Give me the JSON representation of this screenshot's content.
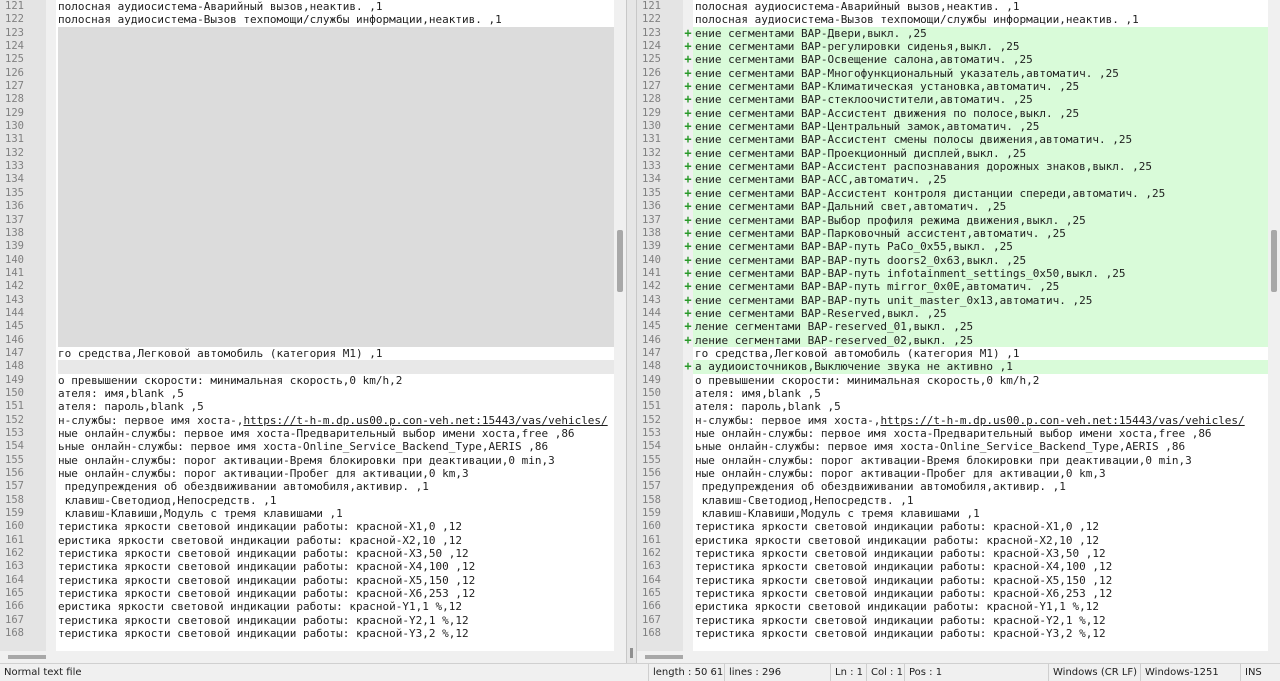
{
  "left_pane": {
    "rows": [
      {
        "n": "121",
        "type": "normal",
        "text": "полосная аудиосистема-Аварийный вызов,неактив. ,1"
      },
      {
        "n": "122",
        "type": "normal",
        "text": "полосная аудиосистема-Вызов техпомощи/службы информации,неактив. ,1"
      },
      {
        "n": "123",
        "type": "blank",
        "text": ""
      },
      {
        "n": "124",
        "type": "blank",
        "text": ""
      },
      {
        "n": "125",
        "type": "blank",
        "text": ""
      },
      {
        "n": "126",
        "type": "blank",
        "text": ""
      },
      {
        "n": "127",
        "type": "blank",
        "text": ""
      },
      {
        "n": "128",
        "type": "blank",
        "text": ""
      },
      {
        "n": "129",
        "type": "blank",
        "text": ""
      },
      {
        "n": "130",
        "type": "blank",
        "text": ""
      },
      {
        "n": "131",
        "type": "blank",
        "text": ""
      },
      {
        "n": "132",
        "type": "blank",
        "text": ""
      },
      {
        "n": "133",
        "type": "blank",
        "text": ""
      },
      {
        "n": "134",
        "type": "blank",
        "text": ""
      },
      {
        "n": "135",
        "type": "blank",
        "text": ""
      },
      {
        "n": "136",
        "type": "blank",
        "text": ""
      },
      {
        "n": "137",
        "type": "blank",
        "text": ""
      },
      {
        "n": "138",
        "type": "blank",
        "text": ""
      },
      {
        "n": "139",
        "type": "blank",
        "text": ""
      },
      {
        "n": "140",
        "type": "blank",
        "text": ""
      },
      {
        "n": "141",
        "type": "blank",
        "text": ""
      },
      {
        "n": "142",
        "type": "blank",
        "text": ""
      },
      {
        "n": "143",
        "type": "blank",
        "text": ""
      },
      {
        "n": "144",
        "type": "blank",
        "text": ""
      },
      {
        "n": "145",
        "type": "blank",
        "text": ""
      },
      {
        "n": "146",
        "type": "blank",
        "text": ""
      },
      {
        "n": "147",
        "type": "normal",
        "text": "го средства,Легковой автомобиль (категория M1) ,1"
      },
      {
        "n": "148",
        "type": "changed",
        "text": ""
      },
      {
        "n": "149",
        "type": "normal",
        "text": "о превышении скорости: минимальная скорость,0 km/h,2"
      },
      {
        "n": "150",
        "type": "normal",
        "text": "ателя: имя,blank ,5"
      },
      {
        "n": "151",
        "type": "normal",
        "text": "ателя: пароль,blank ,5"
      },
      {
        "n": "152",
        "type": "normal",
        "text": "н-службы: первое имя хоста-,",
        "link": "https://t-h-m.dp.us00.p.con-veh.net:15443/vas/vehicles/"
      },
      {
        "n": "153",
        "type": "normal",
        "text": "ные онлайн-службы: первое имя хоста-Предварительный выбор имени хоста,free ,86"
      },
      {
        "n": "154",
        "type": "normal",
        "text": "ьные онлайн-службы: первое имя хоста-Online_Service_Backend_Type,AERIS ,86"
      },
      {
        "n": "155",
        "type": "normal",
        "text": "ные онлайн-службы: порог активации-Время блокировки при деактивации,0 min,3"
      },
      {
        "n": "156",
        "type": "normal",
        "text": "ные онлайн-службы: порог активации-Пробег для активации,0 km,3"
      },
      {
        "n": "157",
        "type": "normal",
        "text": " предупреждения об обездвиживании автомобиля,активир. ,1"
      },
      {
        "n": "158",
        "type": "normal",
        "text": " клавиш-Светодиод,Непосредств. ,1"
      },
      {
        "n": "159",
        "type": "normal",
        "text": " клавиш-Клавиши,Модуль с тремя клавишами ,1"
      },
      {
        "n": "160",
        "type": "normal",
        "text": "теристика яркости световой индикации работы: красной-X1,0 ,12"
      },
      {
        "n": "161",
        "type": "normal",
        "text": "еристика яркости световой индикации работы: красной-X2,10 ,12"
      },
      {
        "n": "162",
        "type": "normal",
        "text": "теристика яркости световой индикации работы: красной-X3,50 ,12"
      },
      {
        "n": "163",
        "type": "normal",
        "text": "теристика яркости световой индикации работы: красной-X4,100 ,12"
      },
      {
        "n": "164",
        "type": "normal",
        "text": "теристика яркости световой индикации работы: красной-X5,150 ,12"
      },
      {
        "n": "165",
        "type": "normal",
        "text": "теристика яркости световой индикации работы: красной-X6,253 ,12"
      },
      {
        "n": "166",
        "type": "normal",
        "text": "еристика яркости световой индикации работы: красной-Y1,1 %,12"
      },
      {
        "n": "167",
        "type": "normal",
        "text": "теристика яркости световой индикации работы: красной-Y2,1 %,12"
      },
      {
        "n": "168",
        "type": "normal",
        "text": "теристика яркости световой индикации работы: красной-Y3,2 %,12"
      }
    ]
  },
  "right_pane": {
    "rows": [
      {
        "n": "121",
        "type": "normal",
        "text": "полосная аудиосистема-Аварийный вызов,неактив. ,1"
      },
      {
        "n": "122",
        "type": "normal",
        "text": "полосная аудиосистема-Вызов техпомощи/службы информации,неактив. ,1"
      },
      {
        "n": "123",
        "type": "added",
        "text": "ение сегментами BAP-Двери,выкл. ,25"
      },
      {
        "n": "124",
        "type": "added",
        "text": "ение сегментами BAP-регулировки сиденья,выкл. ,25"
      },
      {
        "n": "125",
        "type": "added",
        "text": "ение сегментами BAP-Освещение салона,автоматич. ,25"
      },
      {
        "n": "126",
        "type": "added",
        "text": "ение сегментами BAP-Многофункциональный указатель,автоматич. ,25"
      },
      {
        "n": "127",
        "type": "added",
        "text": "ение сегментами BAP-Климатическая установка,автоматич. ,25"
      },
      {
        "n": "128",
        "type": "added",
        "text": "ение сегментами BAP-стеклоочистители,автоматич. ,25"
      },
      {
        "n": "129",
        "type": "added",
        "text": "ение сегментами BAP-Ассистент движения по полосе,выкл. ,25"
      },
      {
        "n": "130",
        "type": "added",
        "text": "ение сегментами BAP-Центральный замок,автоматич. ,25"
      },
      {
        "n": "131",
        "type": "added",
        "text": "ение сегментами BAP-Ассистент смены полосы движения,автоматич. ,25"
      },
      {
        "n": "132",
        "type": "added",
        "text": "ение сегментами BAP-Проекционный дисплей,выкл. ,25"
      },
      {
        "n": "133",
        "type": "added",
        "text": "ение сегментами BAP-Ассистент распознавания дорожных знаков,выкл. ,25"
      },
      {
        "n": "134",
        "type": "added",
        "text": "ение сегментами BAP-ACC,автоматич. ,25"
      },
      {
        "n": "135",
        "type": "added",
        "text": "ение сегментами BAP-Ассистент контроля дистанции спереди,автоматич. ,25"
      },
      {
        "n": "136",
        "type": "added",
        "text": "ение сегментами BAP-Дальний свет,автоматич. ,25"
      },
      {
        "n": "137",
        "type": "added",
        "text": "ение сегментами BAP-Выбор профиля режима движения,выкл. ,25"
      },
      {
        "n": "138",
        "type": "added",
        "text": "ение сегментами BAP-Парковочный ассистент,автоматич. ,25"
      },
      {
        "n": "139",
        "type": "added",
        "text": "ение сегментами BAP-BAP-путь PaCo_0x55,выкл. ,25"
      },
      {
        "n": "140",
        "type": "added",
        "text": "ение сегментами BAP-BAP-путь doors2_0x63,выкл. ,25"
      },
      {
        "n": "141",
        "type": "added",
        "text": "ение сегментами BAP-BAP-путь infotainment_settings_0x50,выкл. ,25"
      },
      {
        "n": "142",
        "type": "added",
        "text": "ение сегментами BAP-BAP-путь mirror_0x0E,автоматич. ,25"
      },
      {
        "n": "143",
        "type": "added",
        "text": "ение сегментами BAP-BAP-путь unit_master_0x13,автоматич. ,25"
      },
      {
        "n": "144",
        "type": "added",
        "text": "ение сегментами BAP-Reserved,выкл. ,25"
      },
      {
        "n": "145",
        "type": "added",
        "text": "ление сегментами BAP-reserved_01,выкл. ,25"
      },
      {
        "n": "146",
        "type": "added",
        "text": "ление сегментами BAP-reserved_02,выкл. ,25"
      },
      {
        "n": "147",
        "type": "normal",
        "text": "го средства,Легковой автомобиль (категория M1) ,1"
      },
      {
        "n": "148",
        "type": "added",
        "text": "а аудиоисточников,Выключение звука не активно ,1"
      },
      {
        "n": "149",
        "type": "normal",
        "text": "о превышении скорости: минимальная скорость,0 km/h,2"
      },
      {
        "n": "150",
        "type": "normal",
        "text": "ателя: имя,blank ,5"
      },
      {
        "n": "151",
        "type": "normal",
        "text": "ателя: пароль,blank ,5"
      },
      {
        "n": "152",
        "type": "normal",
        "text": "н-службы: первое имя хоста-,",
        "link": "https://t-h-m.dp.us00.p.con-veh.net:15443/vas/vehicles/"
      },
      {
        "n": "153",
        "type": "normal",
        "text": "ные онлайн-службы: первое имя хоста-Предварительный выбор имени хоста,free ,86"
      },
      {
        "n": "154",
        "type": "normal",
        "text": "ьные онлайн-службы: первое имя хоста-Online_Service_Backend_Type,AERIS ,86"
      },
      {
        "n": "155",
        "type": "normal",
        "text": "ные онлайн-службы: порог активации-Время блокировки при деактивации,0 min,3"
      },
      {
        "n": "156",
        "type": "normal",
        "text": "ные онлайн-службы: порог активации-Пробег для активации,0 km,3"
      },
      {
        "n": "157",
        "type": "normal",
        "text": " предупреждения об обездвиживании автомобиля,активир. ,1"
      },
      {
        "n": "158",
        "type": "normal",
        "text": " клавиш-Светодиод,Непосредств. ,1"
      },
      {
        "n": "159",
        "type": "normal",
        "text": " клавиш-Клавиши,Модуль с тремя клавишами ,1"
      },
      {
        "n": "160",
        "type": "normal",
        "text": "теристика яркости световой индикации работы: красной-X1,0 ,12"
      },
      {
        "n": "161",
        "type": "normal",
        "text": "еристика яркости световой индикации работы: красной-X2,10 ,12"
      },
      {
        "n": "162",
        "type": "normal",
        "text": "теристика яркости световой индикации работы: красной-X3,50 ,12"
      },
      {
        "n": "163",
        "type": "normal",
        "text": "теристика яркости световой индикации работы: красной-X4,100 ,12"
      },
      {
        "n": "164",
        "type": "normal",
        "text": "теристика яркости световой индикации работы: красной-X5,150 ,12"
      },
      {
        "n": "165",
        "type": "normal",
        "text": "теристика яркости световой индикации работы: красной-X6,253 ,12"
      },
      {
        "n": "166",
        "type": "normal",
        "text": "еристика яркости световой индикации работы: красной-Y1,1 %,12"
      },
      {
        "n": "167",
        "type": "normal",
        "text": "теристика яркости световой индикации работы: красной-Y2,1 %,12"
      },
      {
        "n": "168",
        "type": "normal",
        "text": "теристика яркости световой индикации работы: красной-Y3,2 %,12"
      }
    ]
  },
  "added_marker": "+",
  "icons": {
    "added_marker": "plus-icon",
    "splitter_grip": "grip-icon"
  },
  "colors": {
    "added_background": "#d9fbd9",
    "blank_background": "#dcdcdc",
    "marker": "#2a9a2a"
  },
  "statusbar": {
    "file_type": "Normal text file",
    "length": "length : 50 615",
    "lines": "lines : 296",
    "ln": "Ln : 1",
    "col": "Col : 1",
    "pos": "Pos : 1",
    "eol": "Windows (CR LF)",
    "encoding": "Windows-1251",
    "mode": "INS"
  }
}
